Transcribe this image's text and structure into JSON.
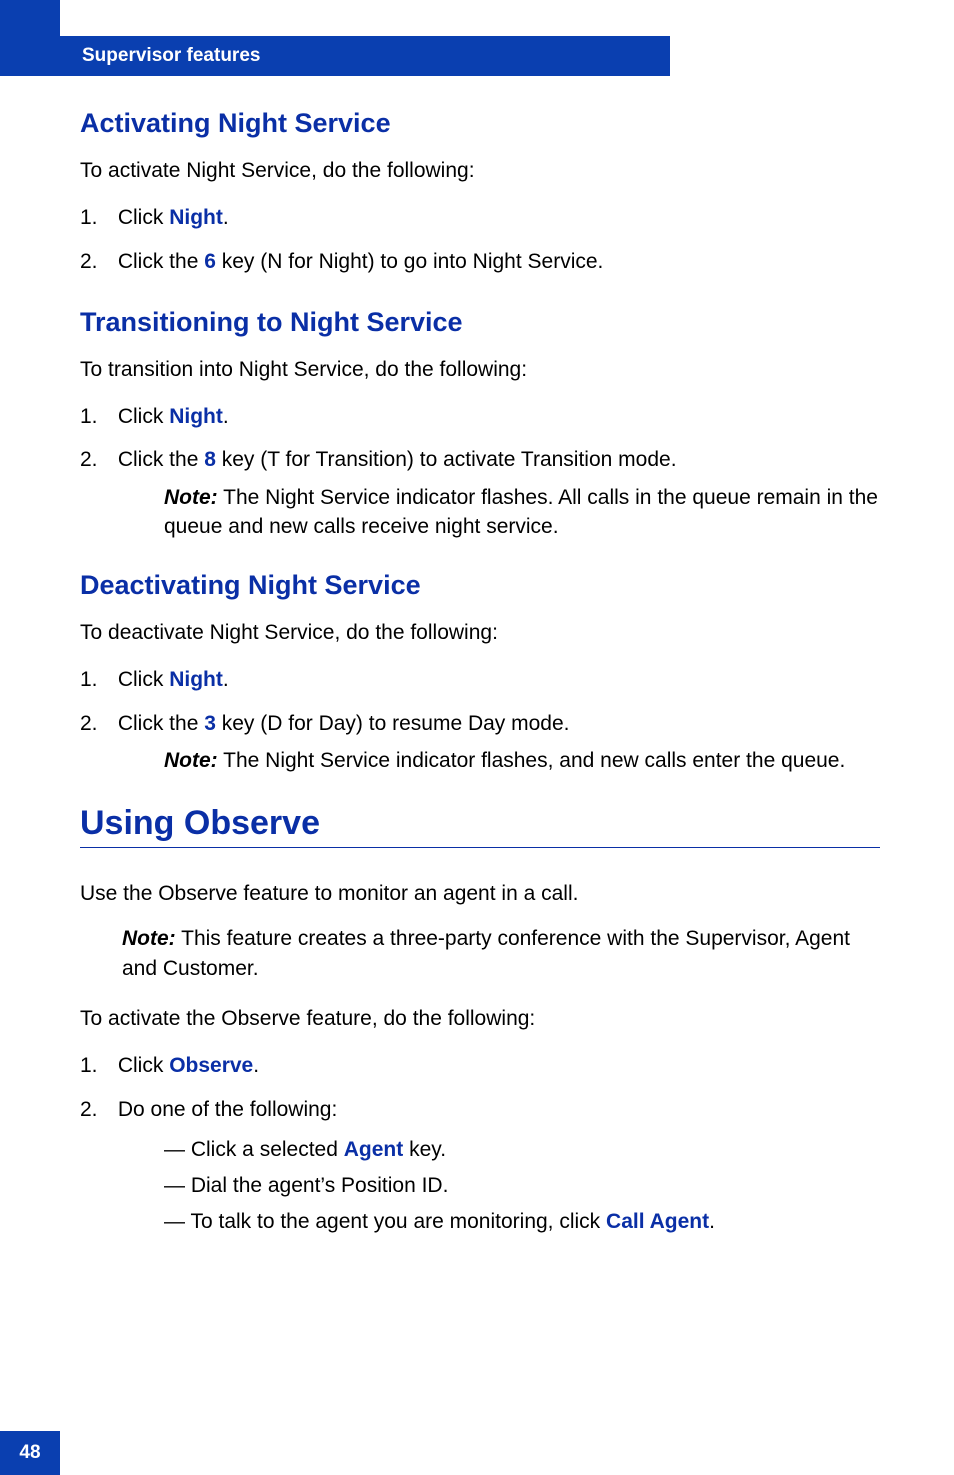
{
  "header": {
    "section_title": "Supervisor features"
  },
  "page_number": "48",
  "sections": {
    "activating": {
      "heading": "Activating Night Service",
      "intro": "To activate Night Service, do the following:",
      "step1_pre": "Click ",
      "step1_ui": "Night",
      "step1_post": ".",
      "step2_pre": "Click the ",
      "step2_ui": "6",
      "step2_post": " key (N for Night) to go into Night Service."
    },
    "transitioning": {
      "heading": "Transitioning to Night Service",
      "intro": "To transition into Night Service, do the following:",
      "step1_pre": "Click ",
      "step1_ui": "Night",
      "step1_post": ".",
      "step2_pre": "Click the ",
      "step2_ui": "8",
      "step2_post": " key (T for Transition) to activate Transition mode.",
      "note_label": "Note:",
      "note_text": " The Night Service indicator flashes. All calls in the queue remain in the queue and new calls receive night service."
    },
    "deactivating": {
      "heading": "Deactivating Night Service",
      "intro": "To deactivate Night Service, do the following:",
      "step1_pre": "Click ",
      "step1_ui": "Night",
      "step1_post": ".",
      "step2_pre": "Click the ",
      "step2_ui": "3",
      "step2_post": " key (D for Day) to resume Day mode.",
      "note_label": "Note:",
      "note_text": " The Night Service indicator flashes, and new calls enter the queue."
    },
    "observe": {
      "heading": "Using Observe",
      "intro1": "Use the Observe feature to monitor an agent in a call.",
      "note_label": "Note:",
      "note_text": " This feature creates a three-party conference with the Supervisor, Agent and Customer.",
      "intro2": "To activate the Observe feature, do the following:",
      "step1_pre": "Click ",
      "step1_ui": "Observe",
      "step1_post": ".",
      "step2_text": "Do one of the following:",
      "bullet1_pre": "Click a selected ",
      "bullet1_ui": "Agent",
      "bullet1_post": " key.",
      "bullet2": "Dial the agent’s Position ID.",
      "bullet3_pre": "To talk to the agent you are monitoring, click ",
      "bullet3_ui": "Call Agent",
      "bullet3_post": "."
    }
  }
}
